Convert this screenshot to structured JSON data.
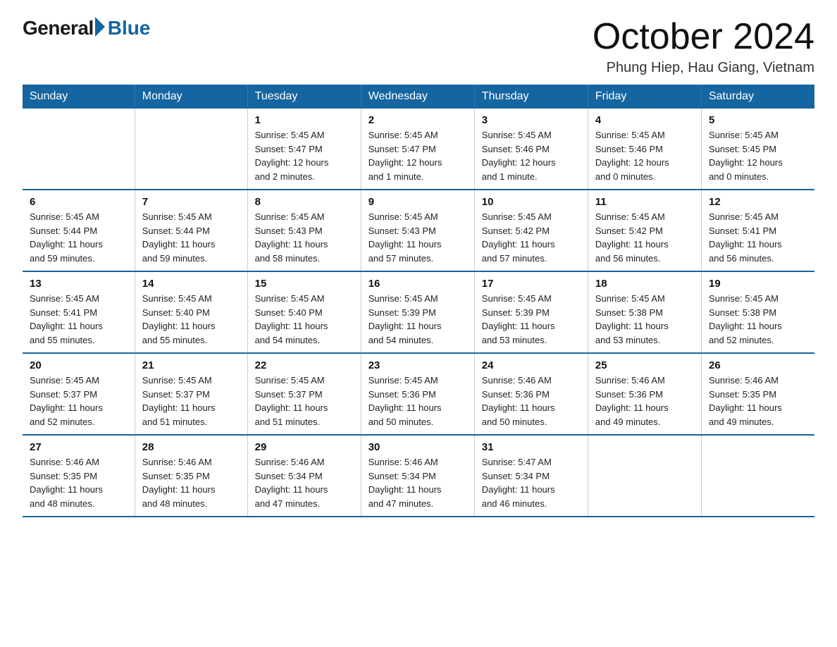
{
  "logo": {
    "general": "General",
    "blue": "Blue"
  },
  "title": "October 2024",
  "location": "Phung Hiep, Hau Giang, Vietnam",
  "header_color": "#1565a0",
  "days_of_week": [
    "Sunday",
    "Monday",
    "Tuesday",
    "Wednesday",
    "Thursday",
    "Friday",
    "Saturday"
  ],
  "weeks": [
    [
      {
        "day": "",
        "info": ""
      },
      {
        "day": "",
        "info": ""
      },
      {
        "day": "1",
        "info": "Sunrise: 5:45 AM\nSunset: 5:47 PM\nDaylight: 12 hours\nand 2 minutes."
      },
      {
        "day": "2",
        "info": "Sunrise: 5:45 AM\nSunset: 5:47 PM\nDaylight: 12 hours\nand 1 minute."
      },
      {
        "day": "3",
        "info": "Sunrise: 5:45 AM\nSunset: 5:46 PM\nDaylight: 12 hours\nand 1 minute."
      },
      {
        "day": "4",
        "info": "Sunrise: 5:45 AM\nSunset: 5:46 PM\nDaylight: 12 hours\nand 0 minutes."
      },
      {
        "day": "5",
        "info": "Sunrise: 5:45 AM\nSunset: 5:45 PM\nDaylight: 12 hours\nand 0 minutes."
      }
    ],
    [
      {
        "day": "6",
        "info": "Sunrise: 5:45 AM\nSunset: 5:44 PM\nDaylight: 11 hours\nand 59 minutes."
      },
      {
        "day": "7",
        "info": "Sunrise: 5:45 AM\nSunset: 5:44 PM\nDaylight: 11 hours\nand 59 minutes."
      },
      {
        "day": "8",
        "info": "Sunrise: 5:45 AM\nSunset: 5:43 PM\nDaylight: 11 hours\nand 58 minutes."
      },
      {
        "day": "9",
        "info": "Sunrise: 5:45 AM\nSunset: 5:43 PM\nDaylight: 11 hours\nand 57 minutes."
      },
      {
        "day": "10",
        "info": "Sunrise: 5:45 AM\nSunset: 5:42 PM\nDaylight: 11 hours\nand 57 minutes."
      },
      {
        "day": "11",
        "info": "Sunrise: 5:45 AM\nSunset: 5:42 PM\nDaylight: 11 hours\nand 56 minutes."
      },
      {
        "day": "12",
        "info": "Sunrise: 5:45 AM\nSunset: 5:41 PM\nDaylight: 11 hours\nand 56 minutes."
      }
    ],
    [
      {
        "day": "13",
        "info": "Sunrise: 5:45 AM\nSunset: 5:41 PM\nDaylight: 11 hours\nand 55 minutes."
      },
      {
        "day": "14",
        "info": "Sunrise: 5:45 AM\nSunset: 5:40 PM\nDaylight: 11 hours\nand 55 minutes."
      },
      {
        "day": "15",
        "info": "Sunrise: 5:45 AM\nSunset: 5:40 PM\nDaylight: 11 hours\nand 54 minutes."
      },
      {
        "day": "16",
        "info": "Sunrise: 5:45 AM\nSunset: 5:39 PM\nDaylight: 11 hours\nand 54 minutes."
      },
      {
        "day": "17",
        "info": "Sunrise: 5:45 AM\nSunset: 5:39 PM\nDaylight: 11 hours\nand 53 minutes."
      },
      {
        "day": "18",
        "info": "Sunrise: 5:45 AM\nSunset: 5:38 PM\nDaylight: 11 hours\nand 53 minutes."
      },
      {
        "day": "19",
        "info": "Sunrise: 5:45 AM\nSunset: 5:38 PM\nDaylight: 11 hours\nand 52 minutes."
      }
    ],
    [
      {
        "day": "20",
        "info": "Sunrise: 5:45 AM\nSunset: 5:37 PM\nDaylight: 11 hours\nand 52 minutes."
      },
      {
        "day": "21",
        "info": "Sunrise: 5:45 AM\nSunset: 5:37 PM\nDaylight: 11 hours\nand 51 minutes."
      },
      {
        "day": "22",
        "info": "Sunrise: 5:45 AM\nSunset: 5:37 PM\nDaylight: 11 hours\nand 51 minutes."
      },
      {
        "day": "23",
        "info": "Sunrise: 5:45 AM\nSunset: 5:36 PM\nDaylight: 11 hours\nand 50 minutes."
      },
      {
        "day": "24",
        "info": "Sunrise: 5:46 AM\nSunset: 5:36 PM\nDaylight: 11 hours\nand 50 minutes."
      },
      {
        "day": "25",
        "info": "Sunrise: 5:46 AM\nSunset: 5:36 PM\nDaylight: 11 hours\nand 49 minutes."
      },
      {
        "day": "26",
        "info": "Sunrise: 5:46 AM\nSunset: 5:35 PM\nDaylight: 11 hours\nand 49 minutes."
      }
    ],
    [
      {
        "day": "27",
        "info": "Sunrise: 5:46 AM\nSunset: 5:35 PM\nDaylight: 11 hours\nand 48 minutes."
      },
      {
        "day": "28",
        "info": "Sunrise: 5:46 AM\nSunset: 5:35 PM\nDaylight: 11 hours\nand 48 minutes."
      },
      {
        "day": "29",
        "info": "Sunrise: 5:46 AM\nSunset: 5:34 PM\nDaylight: 11 hours\nand 47 minutes."
      },
      {
        "day": "30",
        "info": "Sunrise: 5:46 AM\nSunset: 5:34 PM\nDaylight: 11 hours\nand 47 minutes."
      },
      {
        "day": "31",
        "info": "Sunrise: 5:47 AM\nSunset: 5:34 PM\nDaylight: 11 hours\nand 46 minutes."
      },
      {
        "day": "",
        "info": ""
      },
      {
        "day": "",
        "info": ""
      }
    ]
  ]
}
